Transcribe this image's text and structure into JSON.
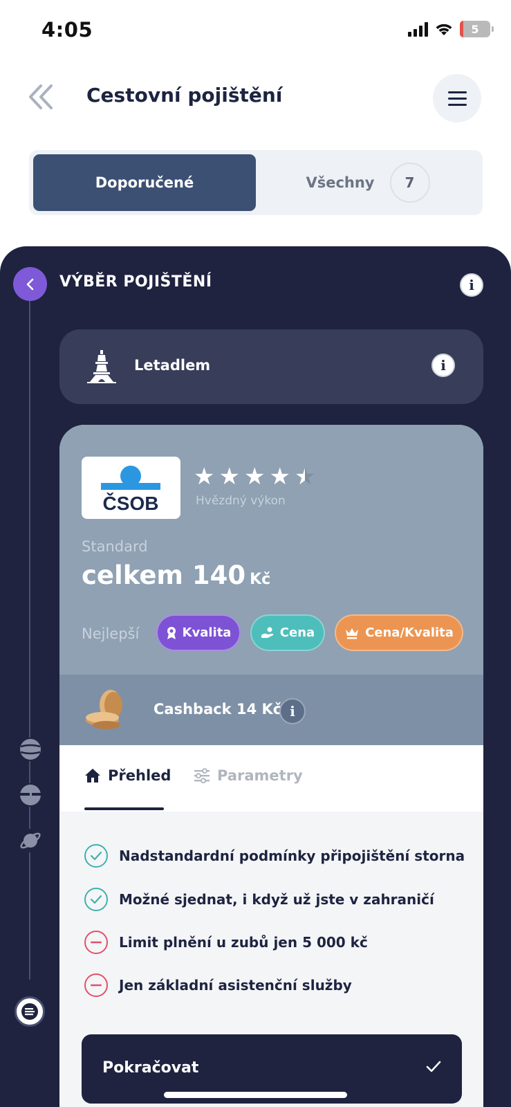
{
  "status": {
    "time": "4:05",
    "battery": "5"
  },
  "header": {
    "title": "Cestovní pojištění"
  },
  "segment": {
    "recommended": "Doporučené",
    "all": "Všechny",
    "all_count": "7"
  },
  "panel": {
    "title": "VÝBĚR POJIŠTĚNÍ",
    "info": "i"
  },
  "transport": {
    "label": "Letadlem",
    "info": "i"
  },
  "offer": {
    "provider": "ČSOB",
    "rating": 4.5,
    "rating_label": "Hvězdný výkon",
    "variant": "Standard",
    "price": "celkem 140",
    "currency": "Kč",
    "best_label": "Nejlepší",
    "badges": [
      "Kvalita",
      "Cena",
      "Cena/Kvalita"
    ],
    "cashback": "Cashback 14 Kč",
    "cashback_info": "i"
  },
  "tabs": {
    "overview": "Přehled",
    "params": "Parametry"
  },
  "features": [
    {
      "text": "Nadstandardní podmínky připojištění storna",
      "type": "positive"
    },
    {
      "text": "Možné sjednat, i když už jste v zahraničí",
      "type": "positive"
    },
    {
      "text": "Limit plnění u zubů jen 5 000 kč",
      "type": "negative"
    },
    {
      "text": "Jen základní asistenční služby",
      "type": "negative"
    }
  ],
  "continue": {
    "label": "Pokračovat"
  },
  "colors": {
    "dark": "#1f2340",
    "accent_purple": "#7e52d4",
    "accent_teal": "#4dbebb",
    "accent_orange": "#ec9552",
    "positive": "#3fb1ae",
    "negative": "#e2506b"
  }
}
